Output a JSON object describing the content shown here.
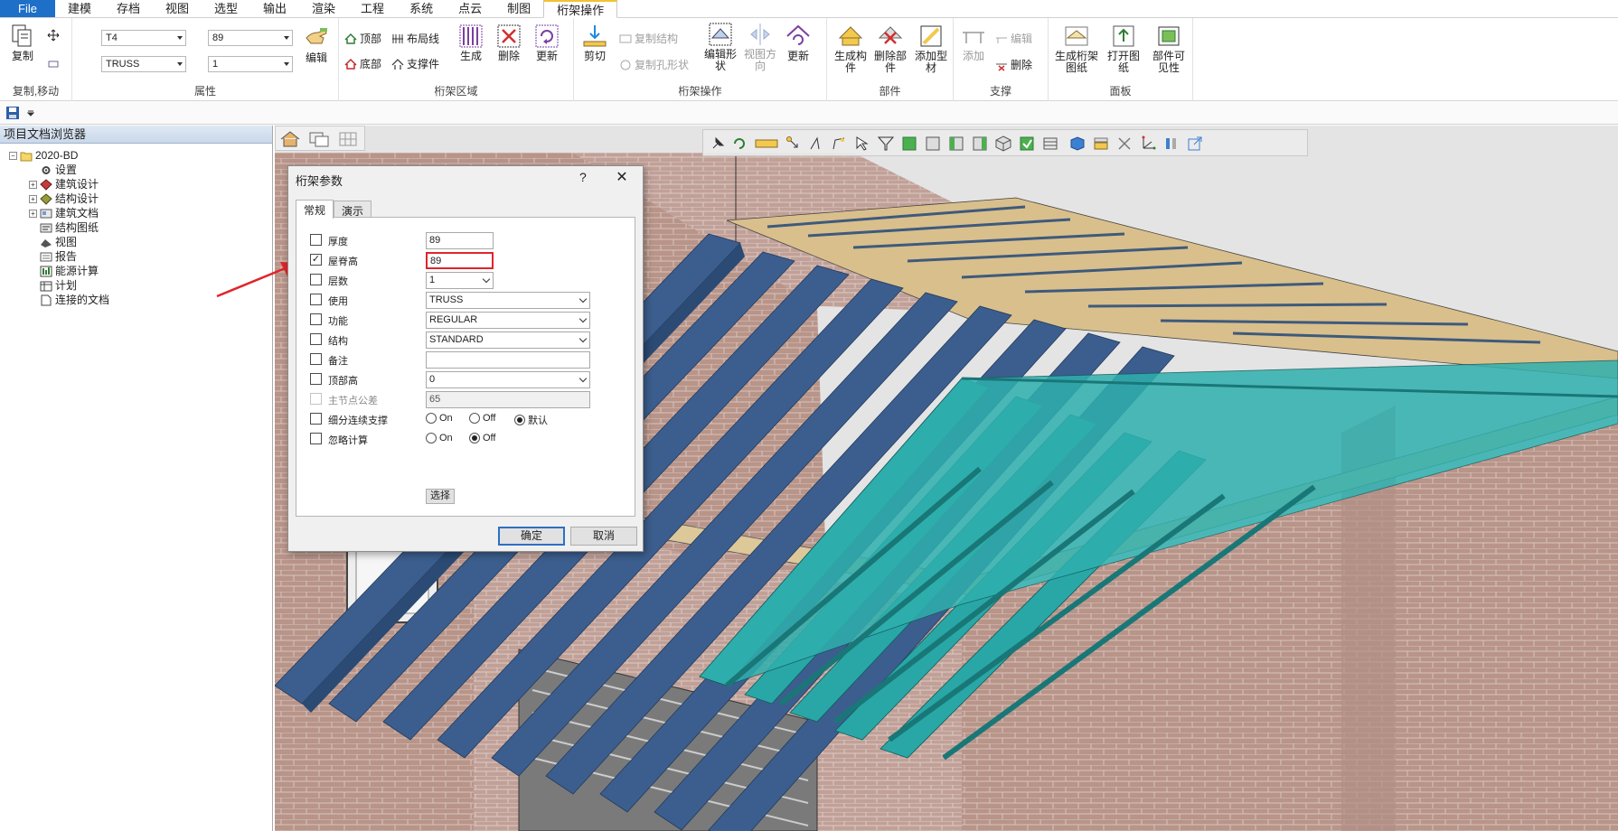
{
  "menu": [
    "File",
    "建模",
    "存档",
    "视图",
    "选型",
    "输出",
    "渲染",
    "工程",
    "系统",
    "点云",
    "制图",
    "桁架操作"
  ],
  "ribbon": {
    "group_copy": {
      "label": "复制,移动",
      "copy": "复制"
    },
    "group_props": {
      "label": "属性",
      "combo1": "T4",
      "combo2": "89",
      "combo3": "TRUSS",
      "combo4": "1",
      "edit": "编辑"
    },
    "group_area": {
      "label": "桁架区域",
      "top": "顶部",
      "layout_line": "布局线",
      "bottom": "底部",
      "support": "支撑件",
      "generate": "生成",
      "delete": "删除",
      "update": "更新"
    },
    "group_ops": {
      "label": "桁架操作",
      "cut": "剪切",
      "copy_structure": "复制结构",
      "copy_hole": "复制孔形状",
      "edit_shape": "编辑形状",
      "view_dir": "视图方向",
      "update": "更新"
    },
    "group_parts": {
      "label": "部件",
      "gen_parts": "生成构件",
      "del_parts": "删除部件",
      "add_profile": "添加型材"
    },
    "group_support": {
      "label": "支撑",
      "add": "添加",
      "edit": "编辑",
      "delete": "删除"
    },
    "group_panel": {
      "label": "面板",
      "gen_drawing": "生成桁架图纸",
      "open_drawing": "打开图纸",
      "visibility": "部件可见性"
    }
  },
  "browser": {
    "title": "项目文档浏览器",
    "root": "2020-BD",
    "items": [
      "设置",
      "建筑设计",
      "结构设计",
      "建筑文档",
      "结构图纸",
      "视图",
      "报告",
      "能源计算",
      "计划",
      "连接的文档"
    ]
  },
  "dialog": {
    "title": "桁架参数",
    "help": "?",
    "close": "✕",
    "tabs": [
      "常规",
      "演示"
    ],
    "rows": [
      {
        "label": "厚度",
        "value": "89",
        "checked": false
      },
      {
        "label": "屋脊高",
        "value": "89",
        "checked": true
      },
      {
        "label": "层数",
        "value": "1",
        "checked": false
      },
      {
        "label": "使用",
        "value": "TRUSS",
        "checked": false
      },
      {
        "label": "功能",
        "value": "REGULAR",
        "checked": false
      },
      {
        "label": "结构",
        "value": "STANDARD",
        "checked": false
      },
      {
        "label": "备注",
        "value": "",
        "checked": false
      },
      {
        "label": "顶部高",
        "value": "0",
        "checked": false
      },
      {
        "label": "主节点公差",
        "value": "65",
        "checked": false
      },
      {
        "label": "细分连续支撑",
        "value": "",
        "checked": false
      },
      {
        "label": "忽略计算",
        "value": "",
        "checked": false
      }
    ],
    "radio_on": "On",
    "radio_off": "Off",
    "radio_default": "默认",
    "select_btn": "选择",
    "ok": "确定",
    "cancel": "取消"
  },
  "colors": {
    "accent": "#1e6fc8",
    "truss_blue": "#3e5f8f",
    "truss_teal": "#28a8a8",
    "brick": "#b48f84",
    "highlight": "#e0242b"
  }
}
